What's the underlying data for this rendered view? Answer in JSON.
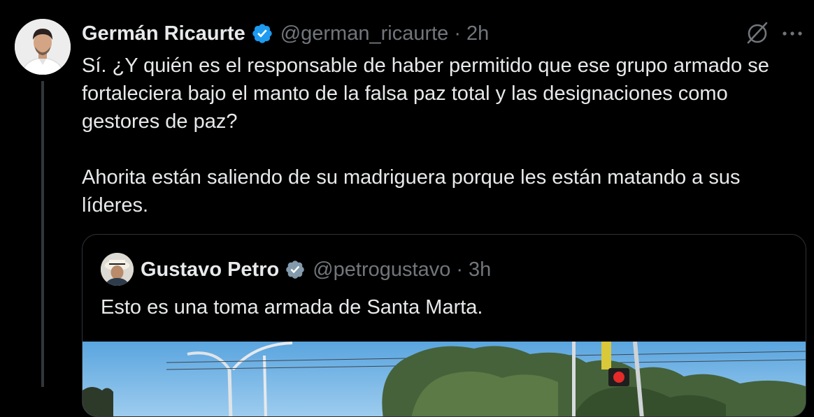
{
  "tweet": {
    "author_name": "Germán Ricaurte",
    "handle": "@german_ricaurte",
    "separator": "·",
    "time": "2h",
    "paragraphs": [
      "Sí. ¿Y quién es el responsable de haber permitido que ese grupo armado se fortaleciera bajo el manto de la falsa paz total y las designaciones como gestores de paz?",
      "Ahorita están saliendo de su madriguera porque les están matando a sus líderes."
    ]
  },
  "quoted_tweet": {
    "author_name": "Gustavo Petro",
    "handle": "@petrogustavo",
    "separator": "·",
    "time": "3h",
    "text": "Esto es una toma armada de Santa Marta."
  },
  "icons": {
    "grok": "grok-icon",
    "more": "more-options-icon",
    "verified": "verified-badge-icon"
  },
  "colors": {
    "background": "#000000",
    "text": "#e7e9ea",
    "muted": "#71767b",
    "verified": "#1d9bf0",
    "quote_verified": "#829aab",
    "border": "#2f3336"
  }
}
